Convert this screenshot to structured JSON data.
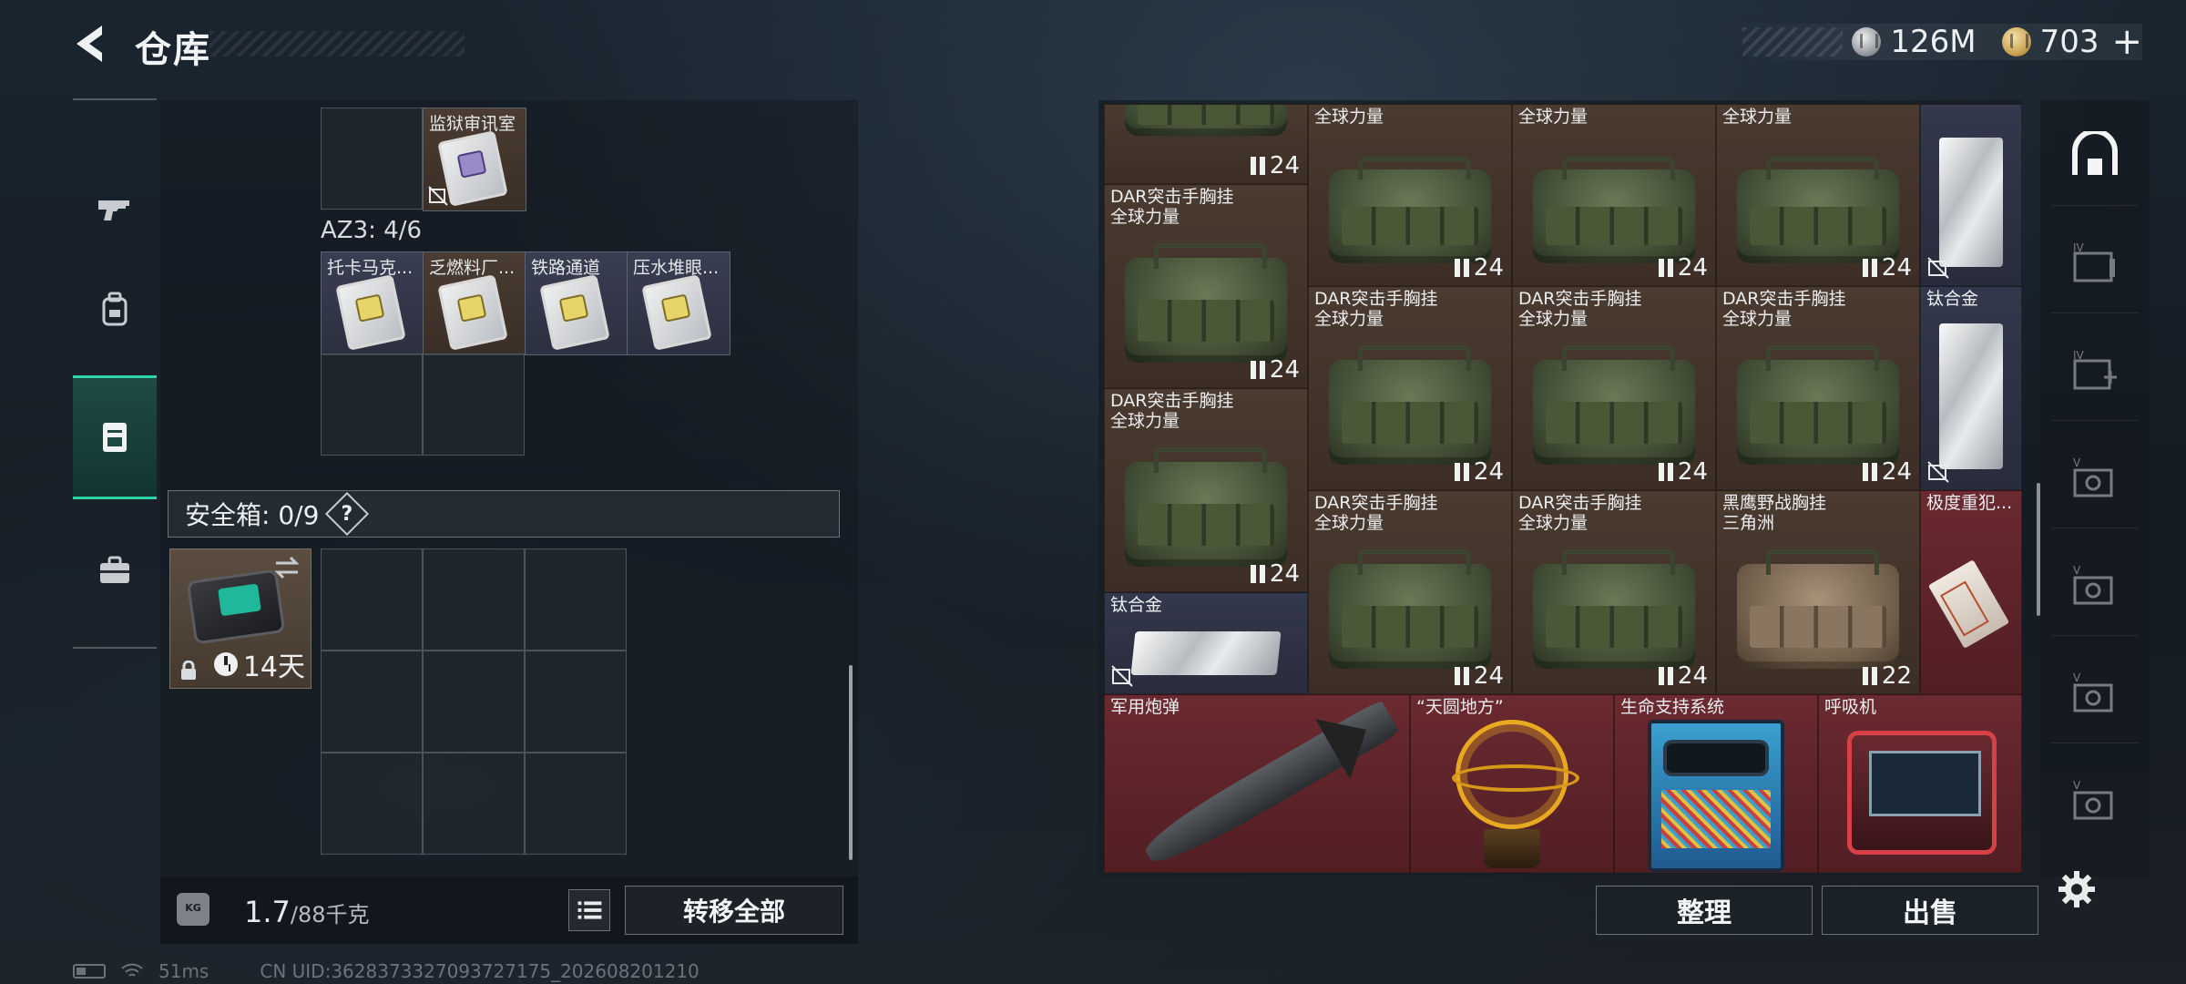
{
  "header": {
    "title": "仓库",
    "currency": [
      {
        "icon": "silver-coin-icon",
        "value": "126M"
      },
      {
        "icon": "gold-coin-icon",
        "value": "703"
      }
    ],
    "plus": "+"
  },
  "left_nav": {
    "items": [
      {
        "icon": "gun-icon"
      },
      {
        "icon": "backpack-icon"
      },
      {
        "icon": "locker-icon",
        "active": true
      },
      {
        "icon": "briefcase-icon"
      }
    ]
  },
  "left_panel": {
    "top_item": {
      "name": "监狱审讯室"
    },
    "az3_label": "AZ3: 4/6",
    "az3_items": [
      {
        "name": "托卡马克..."
      },
      {
        "name": "乏燃料厂..."
      },
      {
        "name": "铁路通道"
      },
      {
        "name": "压水堆眼..."
      }
    ],
    "safe_box": {
      "label": "安全箱: 0/9",
      "help": "?",
      "days": "14天"
    },
    "weight": {
      "current": "1.7",
      "max": "/88千克"
    },
    "kg_icon": "KG",
    "transfer_all": "转移全部"
  },
  "right_panel": {
    "cells": [
      {
        "name": "",
        "count": "24",
        "style": "brown",
        "kind": "bag"
      },
      {
        "name": "全球力量",
        "count": "",
        "style": "brown",
        "kind": "bag"
      },
      {
        "name": "全球力量",
        "count": "",
        "style": "brown",
        "kind": "bag"
      },
      {
        "name": "全球力量",
        "count": "",
        "style": "brown",
        "kind": "bag"
      },
      {
        "name": "DAR突击手胸挂\n全球力量",
        "count": "24",
        "style": "brown",
        "kind": "bag"
      },
      {
        "name": "",
        "count": "24",
        "style": "brown",
        "kind": "bag"
      },
      {
        "name": "",
        "count": "24",
        "style": "brown",
        "kind": "bag"
      },
      {
        "name": "",
        "count": "24",
        "style": "brown",
        "kind": "bag"
      },
      {
        "name": "DAR突击手胸挂\n全球力量",
        "count": "24",
        "style": "brown",
        "kind": "bag"
      },
      {
        "name": "DAR突击手胸挂\n全球力量",
        "count": "24",
        "style": "brown",
        "kind": "bag"
      },
      {
        "name": "DAR突击手胸挂\n全球力量",
        "count": "24",
        "style": "brown",
        "kind": "bag"
      },
      {
        "name": "DAR突击手胸挂\n全球力量",
        "count": "24",
        "style": "brown",
        "kind": "bag"
      },
      {
        "name": "DAR突击手胸挂\n全球力量",
        "count": "24",
        "style": "brown",
        "kind": "bag"
      },
      {
        "name": "DAR突击手胸挂\n全球力量",
        "count": "24",
        "style": "brown",
        "kind": "bag"
      },
      {
        "name": "黑鹰野战胸挂\n三角洲",
        "count": "22",
        "style": "brown",
        "kind": "bag-tan"
      },
      {
        "name": "钛合金",
        "count": "",
        "style": "blue",
        "kind": "metal"
      }
    ],
    "side_column": [
      {
        "name": "",
        "style": "blue"
      },
      {
        "name": "钛合金",
        "style": "blue"
      },
      {
        "name": "极度重犯...",
        "style": "red"
      }
    ],
    "bottom_row": [
      {
        "name": "军用炮弹",
        "kind": "missile"
      },
      {
        "name": "“天圆地方”",
        "kind": "sphere"
      },
      {
        "name": "生命支持系统",
        "kind": "machine"
      },
      {
        "name": "呼吸机",
        "kind": "monitor"
      }
    ],
    "sort_button": "整理",
    "sell_button": "出售"
  },
  "right_strip": {
    "icons": [
      "home-safe-icon",
      "folder-iv-icon",
      "folder-iv-add-icon",
      "folder-v-icon",
      "folder-v-icon",
      "folder-v-icon",
      "folder-v-icon"
    ]
  },
  "status_bar": {
    "ping": "51ms",
    "uid": "CN UID:3628373327093727175_202608201210"
  },
  "colors": {
    "accent": "#2fd3a8",
    "brown_cell": "#4a3a30",
    "blue_cell": "#34384c",
    "red_cell": "#6a2a30"
  }
}
